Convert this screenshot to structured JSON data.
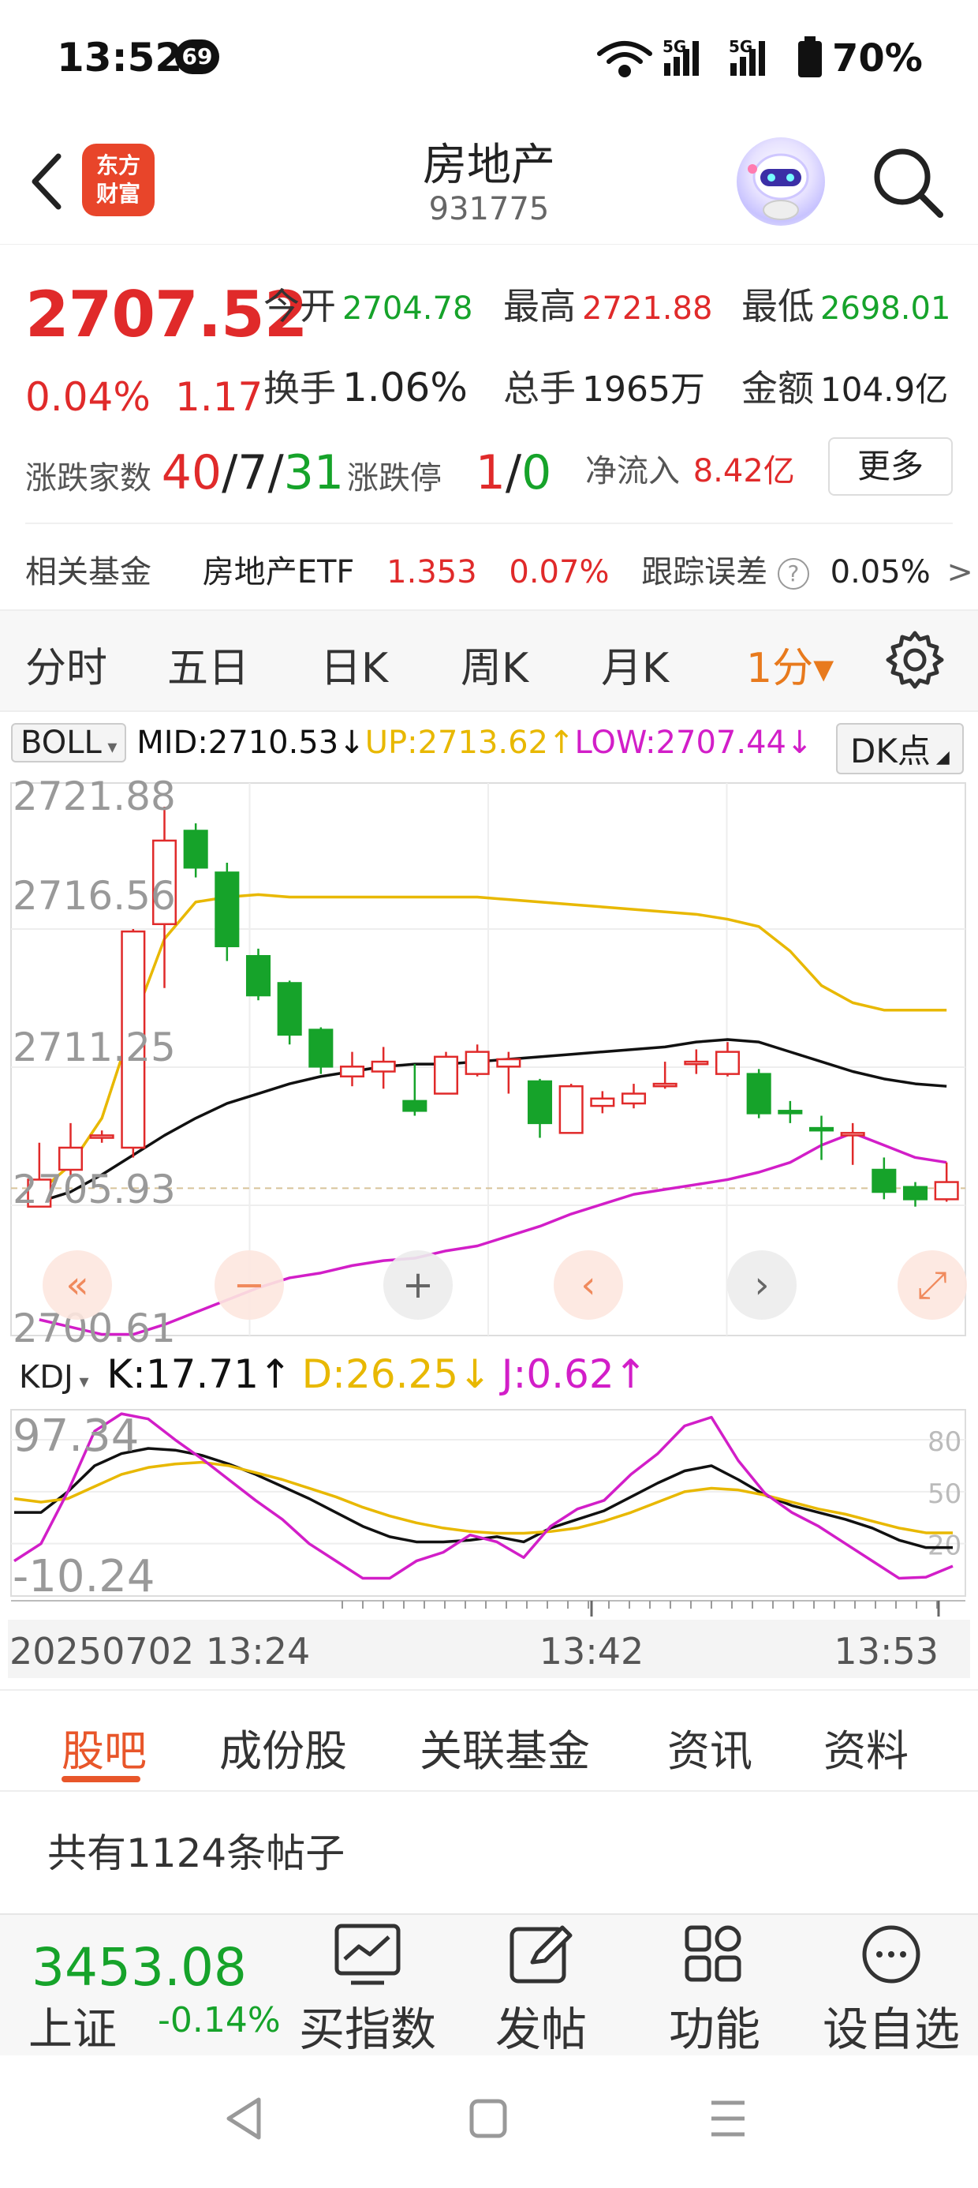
{
  "status_bar": {
    "time": "13:52",
    "notification_count": "69",
    "network": "5G",
    "battery": "70%"
  },
  "header": {
    "logo_line1": "东方",
    "logo_line2": "财富",
    "title": "房地产",
    "code": "931775"
  },
  "quote": {
    "price": "2707.52",
    "change_pct": "0.04%",
    "change_val": "1.17",
    "open_label": "今开",
    "open": "2704.78",
    "high_label": "最高",
    "high": "2721.88",
    "low_label": "最低",
    "low": "2698.01",
    "turnover_label": "换手",
    "turnover": "1.06%",
    "volume_label": "总手",
    "volume": "1965万",
    "amount_label": "金额",
    "amount": "104.9亿",
    "adv_label": "涨跌家数",
    "adv_up": "40",
    "adv_flat": "7",
    "adv_down": "31",
    "limit_label": "涨跌停",
    "limit_up": "1",
    "limit_down": "0",
    "netflow_label": "净流入",
    "netflow": "8.42亿",
    "more": "更多"
  },
  "fund": {
    "label": "相关基金",
    "name": "房地产ETF",
    "price": "1.353",
    "pct": "0.07%",
    "tracking_label": "跟踪误差",
    "help": "?",
    "tracking": "0.05%",
    "arrow": ">"
  },
  "period_tabs": [
    {
      "label": "分时"
    },
    {
      "label": "五日"
    },
    {
      "label": "日K"
    },
    {
      "label": "周K"
    },
    {
      "label": "月K"
    },
    {
      "label": "1分▾",
      "active": true
    }
  ],
  "boll": {
    "name": "BOLL",
    "mid": "MID:2710.53↓",
    "up": "UP:2713.62↑",
    "low": "LOW:2707.44↓",
    "dk": "DK点"
  },
  "kdj": {
    "name": "KDJ",
    "k": "K:17.71↑",
    "d": "D:26.25↓",
    "j": "J:0.62↑"
  },
  "colors": {
    "up": "#e02a2a",
    "down": "#16a32a",
    "mid": "#111111",
    "upper": "#e8b800",
    "lower": "#d21ec8",
    "accent": "#e87a1d"
  },
  "chart_data": [
    {
      "type": "candlestick",
      "indicator": "BOLL",
      "y_axis_labels": [
        "2721.88",
        "2716.56",
        "2711.25",
        "2705.93",
        "2700.61"
      ],
      "ylim": [
        2700.61,
        2721.88
      ],
      "prev_close_line": 2706.35,
      "candles": [
        {
          "o": 2705.6,
          "c": 2706.7,
          "h": 2708.2,
          "l": 2705.6
        },
        {
          "o": 2707.1,
          "c": 2708.0,
          "h": 2709.0,
          "l": 2706.8
        },
        {
          "o": 2708.4,
          "c": 2708.5,
          "h": 2708.7,
          "l": 2708.2
        },
        {
          "o": 2708.0,
          "c": 2716.8,
          "h": 2716.9,
          "l": 2707.6
        },
        {
          "o": 2717.1,
          "c": 2720.5,
          "h": 2721.88,
          "l": 2714.5
        },
        {
          "o": 2720.9,
          "c": 2719.4,
          "h": 2721.2,
          "l": 2719.0
        },
        {
          "o": 2719.2,
          "c": 2716.2,
          "h": 2719.6,
          "l": 2715.6
        },
        {
          "o": 2715.8,
          "c": 2714.2,
          "h": 2716.1,
          "l": 2714.0
        },
        {
          "o": 2714.7,
          "c": 2712.6,
          "h": 2714.8,
          "l": 2712.2
        },
        {
          "o": 2712.8,
          "c": 2711.3,
          "h": 2712.9,
          "l": 2711.0
        },
        {
          "o": 2710.9,
          "c": 2711.3,
          "h": 2711.9,
          "l": 2710.5
        },
        {
          "o": 2711.1,
          "c": 2711.5,
          "h": 2712.1,
          "l": 2710.4
        },
        {
          "o": 2709.9,
          "c": 2709.5,
          "h": 2711.4,
          "l": 2709.3
        },
        {
          "o": 2710.2,
          "c": 2711.7,
          "h": 2711.9,
          "l": 2710.2
        },
        {
          "o": 2711.0,
          "c": 2711.9,
          "h": 2712.2,
          "l": 2710.9
        },
        {
          "o": 2711.3,
          "c": 2711.6,
          "h": 2711.9,
          "l": 2710.2
        },
        {
          "o": 2710.7,
          "c": 2709.0,
          "h": 2710.8,
          "l": 2708.4
        },
        {
          "o": 2708.6,
          "c": 2710.5,
          "h": 2710.6,
          "l": 2708.6
        },
        {
          "o": 2709.7,
          "c": 2710.0,
          "h": 2710.3,
          "l": 2709.4
        },
        {
          "o": 2709.8,
          "c": 2710.2,
          "h": 2710.6,
          "l": 2709.6
        },
        {
          "o": 2710.5,
          "c": 2710.6,
          "h": 2711.5,
          "l": 2710.4
        },
        {
          "o": 2711.4,
          "c": 2711.5,
          "h": 2712.0,
          "l": 2711.0
        },
        {
          "o": 2711.0,
          "c": 2711.9,
          "h": 2712.3,
          "l": 2710.9
        },
        {
          "o": 2711.0,
          "c": 2709.4,
          "h": 2711.2,
          "l": 2709.2
        },
        {
          "o": 2709.5,
          "c": 2709.4,
          "h": 2709.9,
          "l": 2709.0
        },
        {
          "o": 2708.8,
          "c": 2708.7,
          "h": 2709.3,
          "l": 2707.5
        },
        {
          "o": 2708.5,
          "c": 2708.6,
          "h": 2709.0,
          "l": 2707.3
        },
        {
          "o": 2707.1,
          "c": 2706.2,
          "h": 2707.6,
          "l": 2705.9
        },
        {
          "o": 2706.4,
          "c": 2705.9,
          "h": 2706.6,
          "l": 2705.6
        },
        {
          "o": 2705.9,
          "c": 2706.6,
          "h": 2707.4,
          "l": 2705.8
        }
      ],
      "mid_series": [
        2705.8,
        2706.2,
        2706.9,
        2707.7,
        2708.5,
        2709.2,
        2709.8,
        2710.2,
        2710.6,
        2710.9,
        2711.1,
        2711.3,
        2711.4,
        2711.4,
        2711.5,
        2711.6,
        2711.7,
        2711.8,
        2711.9,
        2712.0,
        2712.1,
        2712.3,
        2712.4,
        2712.3,
        2711.9,
        2711.5,
        2711.1,
        2710.8,
        2710.6,
        2710.5
      ],
      "upper_series": [
        2706.2,
        2707.3,
        2709.2,
        2713.1,
        2716.5,
        2718.0,
        2718.2,
        2718.3,
        2718.2,
        2718.2,
        2718.2,
        2718.2,
        2718.2,
        2718.2,
        2718.2,
        2718.1,
        2718.0,
        2717.9,
        2717.8,
        2717.7,
        2717.6,
        2717.5,
        2717.3,
        2717.0,
        2716.0,
        2714.6,
        2713.9,
        2713.6,
        2713.6,
        2713.6
      ],
      "lower_series": [
        2701.0,
        2700.7,
        2700.4,
        2700.4,
        2700.8,
        2701.3,
        2701.8,
        2702.3,
        2702.7,
        2702.9,
        2703.2,
        2703.4,
        2703.5,
        2703.8,
        2704.0,
        2704.4,
        2704.8,
        2705.3,
        2705.7,
        2706.1,
        2706.3,
        2706.5,
        2706.7,
        2707.0,
        2707.4,
        2708.1,
        2708.6,
        2708.1,
        2707.6,
        2707.4
      ]
    },
    {
      "type": "line",
      "indicator": "KDJ",
      "y_axis_labels": [
        "97.34",
        "-10.24"
      ],
      "ylim": [
        -10.24,
        97.34
      ],
      "ref_levels": [
        "80",
        "50",
        "20"
      ],
      "x_labels": [
        "20250702 13:24",
        "13:42",
        "13:53"
      ],
      "series": [
        {
          "name": "K",
          "values": [
            38,
            38,
            50,
            65,
            72,
            75,
            74,
            71,
            66,
            60,
            53,
            46,
            38,
            30,
            24,
            21,
            21,
            22,
            24,
            21,
            29,
            34,
            39,
            47,
            55,
            62,
            65,
            57,
            48,
            42,
            38,
            34,
            29,
            22,
            17.71,
            17.71
          ]
        },
        {
          "name": "D",
          "values": [
            46,
            44,
            46,
            53,
            60,
            64,
            66,
            67,
            65,
            61,
            57,
            52,
            47,
            41,
            36,
            32,
            29,
            27,
            26,
            26,
            27,
            29,
            33,
            38,
            44,
            50,
            52,
            51,
            48,
            44,
            40,
            37,
            33,
            29,
            26.25,
            26.25
          ]
        },
        {
          "name": "J",
          "values": [
            10,
            20,
            50,
            85,
            95,
            92,
            80,
            69,
            57,
            45,
            34,
            20,
            10,
            0,
            0,
            10,
            15,
            25,
            21,
            12,
            30,
            40,
            45,
            60,
            72,
            88,
            93,
            68,
            49,
            38,
            30,
            20,
            10,
            0,
            0.62,
            7
          ]
        }
      ]
    }
  ],
  "content_tabs": [
    {
      "label": "股吧",
      "active": true
    },
    {
      "label": "成份股"
    },
    {
      "label": "关联基金"
    },
    {
      "label": "资讯"
    },
    {
      "label": "资料"
    }
  ],
  "post_count": "共有1124条帖子",
  "bottom_bar": {
    "index_price": "3453.08",
    "index_name": "上证",
    "index_pct": "-0.14%",
    "items": [
      {
        "label": "买指数",
        "icon": "chart-icon"
      },
      {
        "label": "发帖",
        "icon": "edit-icon"
      },
      {
        "label": "功能",
        "icon": "grid-icon"
      },
      {
        "label": "设自选",
        "icon": "more-icon"
      }
    ]
  }
}
